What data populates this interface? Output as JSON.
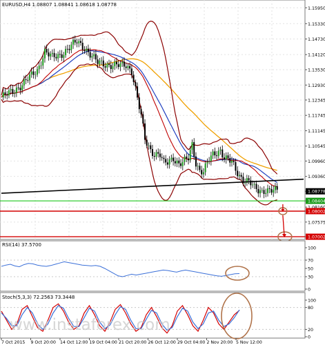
{
  "header": {
    "symbol_line": "EURUSD,H4  1.08807 1.08841 1.08618 1.08778"
  },
  "chart_data": [
    {
      "type": "candlestick",
      "symbol": "EURUSD",
      "timeframe": "H4",
      "ohlc_label": {
        "open": 1.08807,
        "high": 1.08841,
        "low": 1.08618,
        "close": 1.08778
      },
      "y_ticks": [
        "1.15950",
        "1.15330",
        "1.14730",
        "1.14120",
        "1.13530",
        "1.12930",
        "1.12345",
        "1.11745",
        "1.11145",
        "1.10545",
        "1.09960",
        "1.09360",
        "1.08778",
        "1.08404",
        "1.08160",
        "1.08002",
        "1.07575",
        "1.07002"
      ],
      "ylim": [
        1.0695,
        1.162
      ],
      "x_ticks": [
        "7 Oct 2015",
        "9 Oct 20:00",
        "14 Oct 12:00",
        "19 Oct 04:00",
        "21 Oct 20:00",
        "26 Oct 12:00",
        "29 Oct 04:00",
        "2 Nov 20:00",
        "5 Nov 12:00"
      ],
      "price_path": [
        [
          0,
          1.1245
        ],
        [
          6,
          1.1268
        ],
        [
          10,
          1.129
        ],
        [
          16,
          1.133
        ],
        [
          19,
          1.135
        ],
        [
          23,
          1.1425
        ],
        [
          27,
          1.14
        ],
        [
          31,
          1.141
        ],
        [
          36,
          1.144
        ],
        [
          40,
          1.1462
        ],
        [
          44,
          1.144
        ],
        [
          48,
          1.1405
        ],
        [
          51,
          1.138
        ],
        [
          55,
          1.1375
        ],
        [
          59,
          1.137
        ],
        [
          63,
          1.1368
        ],
        [
          66,
          1.1372
        ],
        [
          69,
          1.135
        ],
        [
          72,
          1.124
        ],
        [
          74,
          1.117
        ],
        [
          76,
          1.108
        ],
        [
          79,
          1.104
        ],
        [
          81,
          1.1025
        ],
        [
          84,
          1.102
        ],
        [
          86,
          1.0985
        ],
        [
          88,
          1.099
        ],
        [
          91,
          1.101
        ],
        [
          94,
          1.0985
        ],
        [
          96,
          1.099
        ],
        [
          99,
          1.1005
        ],
        [
          101,
          1.106
        ],
        [
          103,
          1.099
        ],
        [
          105,
          1.096
        ],
        [
          107,
          1.0955
        ],
        [
          110,
          1.1
        ],
        [
          112,
          1.102
        ],
        [
          114,
          1.103
        ],
        [
          116,
          1.104
        ],
        [
          118,
          1.101
        ],
        [
          120,
          1.1
        ],
        [
          122,
          1.099
        ],
        [
          124,
          1.096
        ],
        [
          126,
          1.094
        ],
        [
          128,
          1.0925
        ],
        [
          130,
          1.092
        ],
        [
          132,
          1.0908
        ],
        [
          134,
          1.0888
        ],
        [
          136,
          1.088
        ],
        [
          138,
          1.0878
        ],
        [
          140,
          1.0886
        ],
        [
          142,
          1.0882
        ],
        [
          144,
          1.088
        ],
        [
          146,
          1.0878
        ]
      ],
      "lines": [
        {
          "name": "support-line",
          "color": "#000000",
          "from": [
            0,
            1.087
          ],
          "to": [
            160,
            1.0925
          ]
        },
        {
          "name": "level-1.08404",
          "color": "#00c000",
          "y": 1.08404
        },
        {
          "name": "level-1.08002",
          "color": "#d40000",
          "y": 1.08002
        },
        {
          "name": "level-1.07002",
          "color": "#d40000",
          "y": 1.07002
        }
      ],
      "target_markers": [
        1.08002,
        1.07002
      ],
      "current_price_label": "1.08778",
      "colors": {
        "bollinger": "#8b0000",
        "ma_fast": "#2040c0",
        "ma_slow": "#f0a000",
        "price": "#c00000",
        "annotation": "#b0734a"
      }
    },
    {
      "type": "line",
      "indicator": "RSI",
      "label": "RSI(14) 37.5700",
      "y_ticks": [
        "100",
        "70",
        "50",
        "30",
        "0"
      ],
      "ylim": [
        0,
        100
      ],
      "values": [
        55,
        58,
        60,
        56,
        54,
        59,
        62,
        61,
        58,
        56,
        55,
        57,
        60,
        63,
        66,
        64,
        62,
        60,
        58,
        57,
        56,
        57,
        55,
        50,
        44,
        38,
        32,
        30,
        33,
        36,
        34,
        36,
        38,
        40,
        42,
        44,
        46,
        45,
        43,
        41,
        44,
        46,
        44,
        42,
        40,
        38,
        36,
        34,
        32,
        31,
        33,
        35,
        37,
        37.57
      ],
      "color": "#3a6fd8"
    },
    {
      "type": "line",
      "indicator": "Stochastic",
      "label": "Stoch(5,3,3) 72.2563 73.3448",
      "y_ticks": [
        "100",
        "80",
        "20",
        "0"
      ],
      "ylim": [
        0,
        100
      ],
      "series": [
        {
          "values": [
            70,
            45,
            20,
            35,
            75,
            85,
            55,
            25,
            15,
            45,
            80,
            90,
            70,
            40,
            20,
            30,
            65,
            85,
            60,
            30,
            15,
            40,
            75,
            88,
            65,
            35,
            15,
            25,
            60,
            80,
            55,
            25,
            10,
            30,
            70,
            85,
            60,
            30,
            15,
            45,
            80,
            65,
            35,
            20,
            40,
            60,
            72.2563
          ],
          "color": "#d40000"
        },
        {
          "values": [
            65,
            50,
            30,
            30,
            60,
            80,
            65,
            35,
            20,
            35,
            65,
            85,
            78,
            50,
            28,
            28,
            52,
            78,
            70,
            40,
            22,
            32,
            60,
            82,
            75,
            45,
            22,
            22,
            48,
            72,
            65,
            35,
            18,
            25,
            55,
            78,
            70,
            40,
            22,
            35,
            65,
            70,
            45,
            28,
            35,
            52,
            73.3448
          ],
          "color": "#3a6fd8"
        }
      ]
    }
  ],
  "watermark": "www.instaforex.com"
}
